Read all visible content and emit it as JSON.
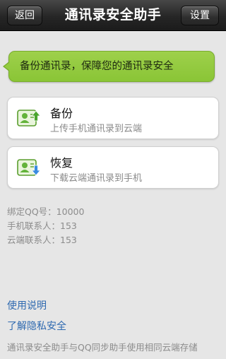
{
  "header": {
    "back_label": "返回",
    "title": "通讯录安全助手",
    "settings_label": "设置"
  },
  "banner": {
    "text": "备份通讯录，保障您的通讯录安全"
  },
  "actions": [
    {
      "icon": "contact-upload-icon",
      "title": "备份",
      "subtitle": "上传手机通讯录到云端"
    },
    {
      "icon": "contact-download-icon",
      "title": "恢复",
      "subtitle": "下载云端通讯录到手机"
    }
  ],
  "info": {
    "qq_line": "绑定QQ号：10000",
    "phone_contacts_line": "手机联系人：153",
    "cloud_contacts_line": "云端联系人：153"
  },
  "links": {
    "usage": "使用说明",
    "privacy": "了解隐私安全"
  },
  "footer": {
    "note": "通讯录安全助手与QQ同步助手使用相同云端存储"
  },
  "colors": {
    "accent_green": "#8ac536",
    "link_blue": "#2e69b0",
    "icon_green": "#63b33a",
    "icon_blue": "#3a8be0"
  }
}
